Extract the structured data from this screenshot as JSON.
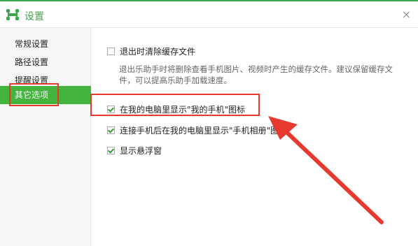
{
  "window": {
    "title": "设置",
    "close_glyph": "×",
    "accent_color": "#43b53f",
    "annotation_color": "#e8392f"
  },
  "sidebar": {
    "items": [
      {
        "label": "常规设置",
        "active": false
      },
      {
        "label": "路径设置",
        "active": false
      },
      {
        "label": "提醒设置",
        "active": false
      },
      {
        "label": "其它选项",
        "active": true
      }
    ]
  },
  "options": {
    "clear_cache": {
      "label": "退出时清除缓存文件",
      "checked": false
    },
    "clear_cache_desc": "退出乐助手时将删除查看手机图片、视频时产生的缓存文件。建议保留缓存文件，可以提高乐助手加载速度。",
    "show_my_phone": {
      "label": "在我的电脑里显示\"我的手机\"图标",
      "checked": true
    },
    "show_phone_album": {
      "label": "连接手机后在我的电脑里显示\"手机相册\"图标",
      "checked": true
    },
    "show_float_window": {
      "label": "显示悬浮窗",
      "checked": true
    }
  }
}
